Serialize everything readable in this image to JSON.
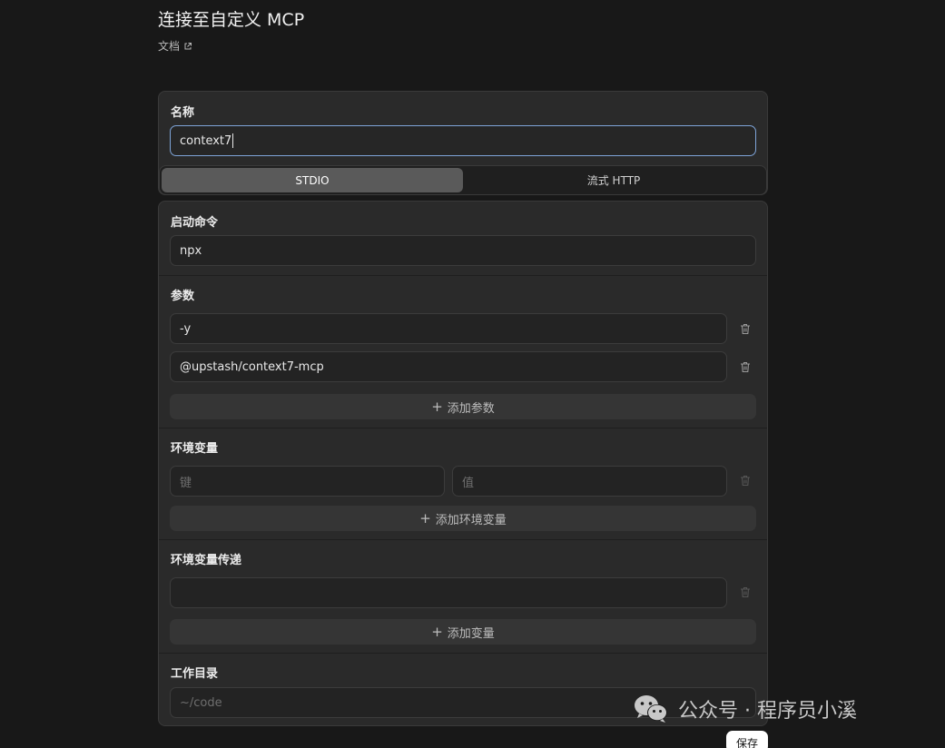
{
  "header": {
    "title": "连接至自定义 MCP",
    "docs_label": "文档"
  },
  "name_section": {
    "label": "名称",
    "value": "context7"
  },
  "transport_tabs": [
    {
      "label": "STDIO",
      "active": true
    },
    {
      "label": "流式 HTTP",
      "active": false
    }
  ],
  "command": {
    "label": "启动命令",
    "value": "npx"
  },
  "args": {
    "label": "参数",
    "items": [
      "-y",
      "@upstash/context7-mcp"
    ],
    "add_label": "添加参数"
  },
  "env": {
    "label": "环境变量",
    "key_placeholder": "键",
    "value_placeholder": "值",
    "add_label": "添加环境变量"
  },
  "env_passthrough": {
    "label": "环境变量传递",
    "value": "",
    "add_label": "添加变量"
  },
  "workdir": {
    "label": "工作目录",
    "placeholder": "~/code"
  },
  "footer": {
    "save_label": "保存"
  },
  "watermark": {
    "text": "公众号 · 程序员小溪"
  },
  "icons": {
    "docs": "external-link-icon",
    "delete": "trash-icon",
    "add": "plus-icon",
    "watermark_logo": "wechat-logo-icon"
  },
  "colors": {
    "background": "#181818",
    "card": "#2a2a2a",
    "focus_border": "#7ea4d8",
    "active_tab": "#5a5a5a",
    "save_button": "#ffffff"
  }
}
